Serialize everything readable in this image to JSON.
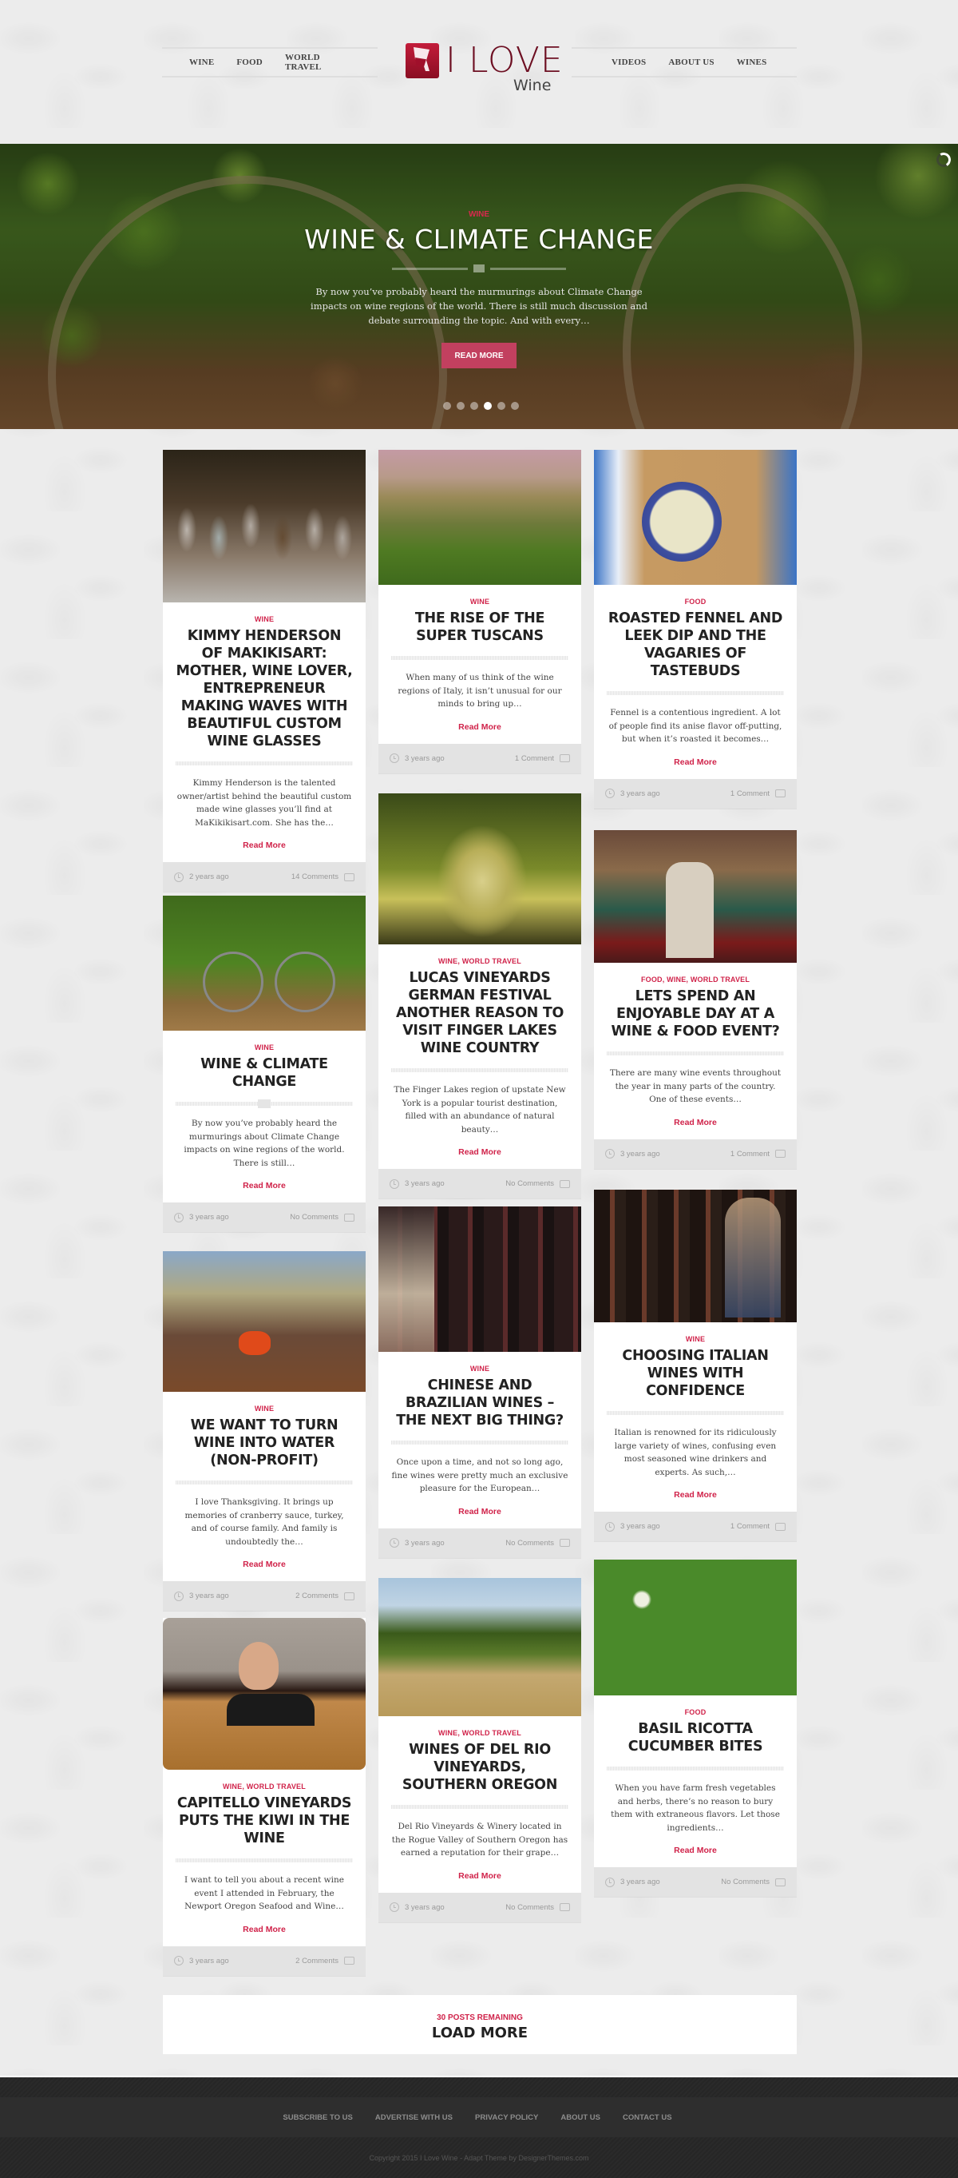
{
  "header": {
    "nav_left": [
      "WINE",
      "FOOD",
      "WORLD TRAVEL"
    ],
    "nav_right": [
      "VIDEOS",
      "ABOUT US",
      "WINES"
    ],
    "logo": {
      "main": "I LOVE",
      "sub": "Wine"
    }
  },
  "hero": {
    "category": "WINE",
    "title": "WINE & CLIMATE CHANGE",
    "excerpt": "By now you’ve probably heard the murmurings about Climate Change impacts on wine regions of the world. There is still much discussion and debate surrounding the topic. And with every…",
    "button_label": "READ MORE",
    "slides_count": 6,
    "active_slide": 4
  },
  "read_more_label": "Read More",
  "posts": [
    {
      "category": "WINE",
      "title": "KIMMY HENDERSON OF MAKIKISART: MOTHER, WINE LOVER, ENTREPRENEUR MAKING WAVES WITH BEAUTIFUL CUSTOM WINE GLASSES",
      "excerpt": "Kimmy Henderson is the talented owner/artist behind the beautiful custom made wine glasses you’ll find at MaKikikisart.com. She has the…",
      "date": "2 years ago",
      "comments": "14 Comments",
      "image": "painted-wine-glasses"
    },
    {
      "category": "WINE",
      "title": "THE RISE OF THE SUPER TUSCANS",
      "excerpt": "When many of us think of the wine regions of Italy, it isn’t unusual for our minds to bring up…",
      "date": "3 years ago",
      "comments": "1 Comment",
      "image": "tuscan-hill-town"
    },
    {
      "category": "FOOD",
      "title": "ROASTED FENNEL AND LEEK DIP AND THE VAGARIES OF TASTEBUDS",
      "excerpt": "Fennel is a contentious ingredient. A lot of people find its anise flavor off-putting, but when it’s roasted it becomes…",
      "date": "3 years ago",
      "comments": "1 Comment",
      "image": "fennel-dip-bowl"
    },
    {
      "category": "WINE",
      "title": "WINE & CLIMATE CHANGE",
      "excerpt": "By now you’ve probably heard the murmurings about Climate Change impacts on wine regions of the world. There is still…",
      "date": "3 years ago",
      "comments": "No Comments",
      "image": "bicycle-in-vineyard",
      "has_video": true
    },
    {
      "category": "WINE, WORLD TRAVEL",
      "title": "LUCAS VINEYARDS GERMAN FESTIVAL ANOTHER REASON TO VISIT FINGER LAKES WINE COUNTRY",
      "excerpt": "The Finger Lakes region of upstate New York is a popular tourist destination, filled with an abundance of natural beauty…",
      "date": "3 years ago",
      "comments": "No Comments",
      "image": "white-grapes"
    },
    {
      "category": "FOOD, WINE, WORLD TRAVEL",
      "title": "LETS SPEND AN ENJOYABLE DAY AT A WINE & FOOD EVENT?",
      "excerpt": "There are many wine events throughout the year in many parts of the country.  One of these events…",
      "date": "3 years ago",
      "comments": "1 Comment",
      "image": "wine-event-booth"
    },
    {
      "category": "WINE",
      "title": "WE WANT TO TURN WINE INTO WATER (NON-PROFIT)",
      "excerpt": "I love Thanksgiving. It brings up memories of cranberry sauce, turkey, and of course family. And family is undoubtedly the…",
      "date": "3 years ago",
      "comments": "2 Comments",
      "image": "village-water-pump"
    },
    {
      "category": "WINE",
      "title": "CHINESE AND BRAZILIAN WINES – THE NEXT BIG THING?",
      "excerpt": "Once upon a time, and not so long ago, fine wines were pretty much an exclusive pleasure for the European…",
      "date": "3 years ago",
      "comments": "No Comments",
      "image": "wine-shop-shelves"
    },
    {
      "category": "WINE",
      "title": "CHOOSING ITALIAN WINES WITH CONFIDENCE",
      "excerpt": "Italian is renowned for its ridiculously large variety of wines, confusing even most seasoned wine drinkers and experts. As such,…",
      "date": "3 years ago",
      "comments": "1 Comment",
      "image": "man-browsing-wines"
    },
    {
      "category": "WINE, WORLD TRAVEL",
      "title": "CAPITELLO VINEYARDS PUTS THE KIWI IN THE WINE",
      "excerpt": "I want to tell you about a recent wine event I attended in February,  the Newport Oregon Seafood and Wine…",
      "date": "3 years ago",
      "comments": "2 Comments",
      "image": "man-in-wine-barrel"
    },
    {
      "category": "WINE, WORLD TRAVEL",
      "title": "WINES OF DEL RIO VINEYARDS, SOUTHERN OREGON",
      "excerpt": "Del Rio Vineyards & Winery located in the Rogue Valley of Southern Oregon has earned a reputation for their grape…",
      "date": "3 years ago",
      "comments": "No Comments",
      "image": "vineyard-rows"
    },
    {
      "category": "FOOD",
      "title": "BASIL RICOTTA CUCUMBER BITES",
      "excerpt": "When you have farm fresh vegetables and herbs, there’s no reason to bury them with extraneous flavors. Let those ingredients…",
      "date": "3 years ago",
      "comments": "No Comments",
      "image": "cucumber-bites-platter"
    }
  ],
  "load_more": {
    "remaining": "30 POSTS REMAINING",
    "label": "LOAD MORE"
  },
  "footer": {
    "links": [
      "SUBSCRIBE TO US",
      "ADVERTISE WITH US",
      "PRIVACY POLICY",
      "ABOUT US",
      "CONTACT US"
    ],
    "copyright": "Copyright 2015 I Love Wine - Adapt Theme by DesignerThemes.com"
  },
  "colors": {
    "accent": "#d0234a",
    "button": "#c2405f",
    "logo": "#6d0f22",
    "footer_bg": "#2a2a2a"
  }
}
